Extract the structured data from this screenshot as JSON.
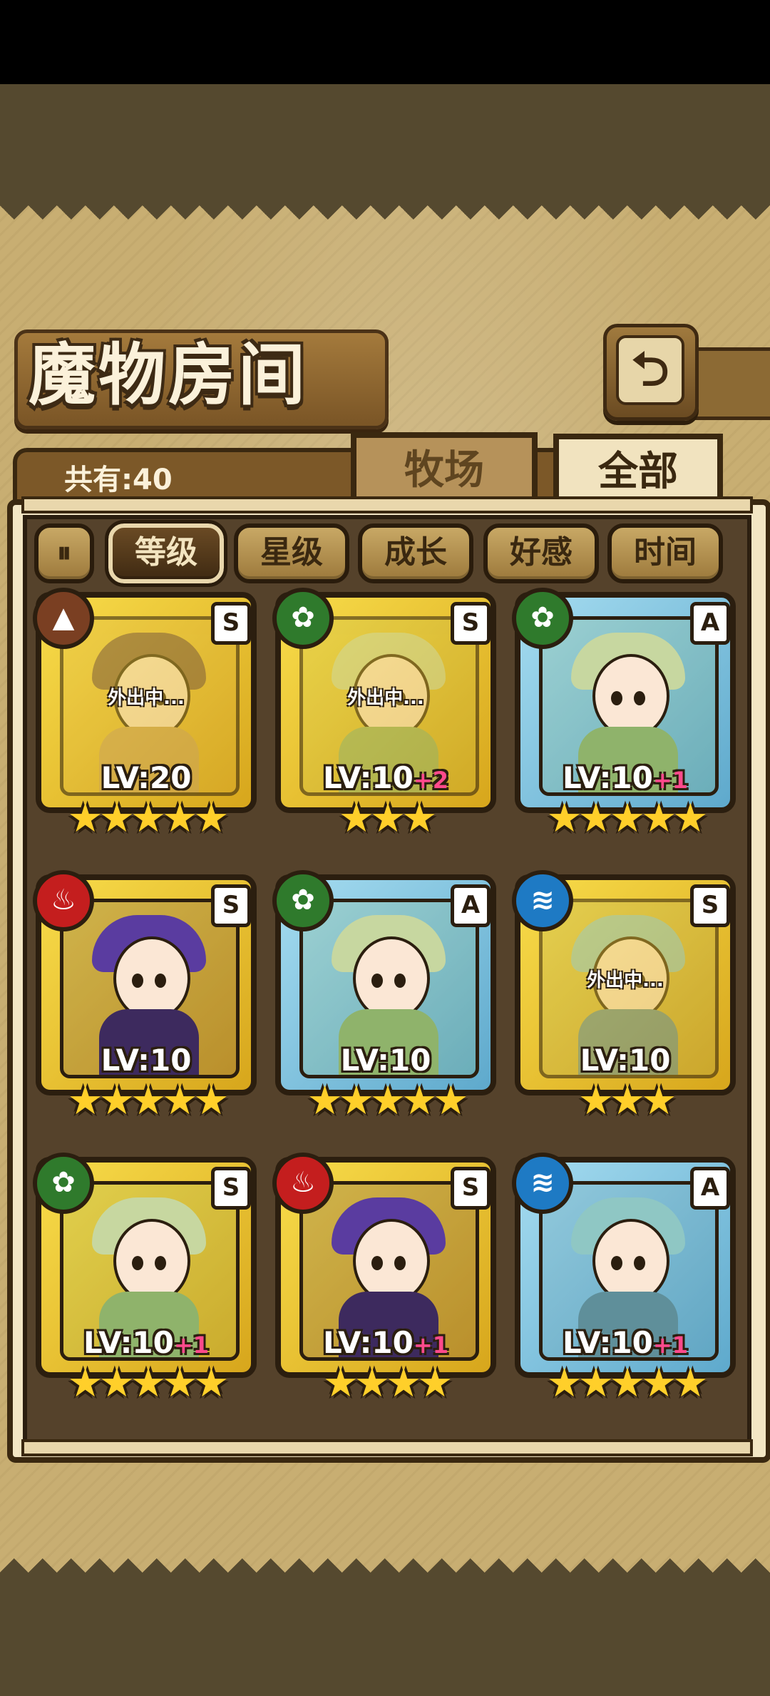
{
  "header": {
    "title": "魔物房间",
    "back_icon": "return-arrow-icon"
  },
  "info": {
    "count_label": "共有:40"
  },
  "tabs": [
    {
      "label": "牧场",
      "active": false
    },
    {
      "label": "全部",
      "active": true
    }
  ],
  "sort": {
    "order_icon": "sort-order-icon",
    "buttons": [
      {
        "label": "等级",
        "active": true
      },
      {
        "label": "星级",
        "active": false
      },
      {
        "label": "成长",
        "active": false
      },
      {
        "label": "好感",
        "active": false
      },
      {
        "label": "时间",
        "active": false
      }
    ]
  },
  "monsters": [
    {
      "element": "earth",
      "rank": "S",
      "level": "LV:20",
      "bonus": "",
      "stars": 5,
      "out_label": "外出中...",
      "frame": "gold"
    },
    {
      "element": "grass",
      "rank": "S",
      "level": "LV:10",
      "bonus": "+2",
      "stars": 3,
      "out_label": "外出中...",
      "frame": "gold"
    },
    {
      "element": "grass",
      "rank": "A",
      "level": "LV:10",
      "bonus": "+1",
      "stars": 5,
      "out_label": "",
      "frame": "blue"
    },
    {
      "element": "fire",
      "rank": "S",
      "level": "LV:10",
      "bonus": "",
      "stars": 5,
      "out_label": "",
      "frame": "gold"
    },
    {
      "element": "grass",
      "rank": "A",
      "level": "LV:10",
      "bonus": "",
      "stars": 5,
      "out_label": "",
      "frame": "blue"
    },
    {
      "element": "water",
      "rank": "S",
      "level": "LV:10",
      "bonus": "",
      "stars": 3,
      "out_label": "外出中...",
      "frame": "gold"
    },
    {
      "element": "grass",
      "rank": "S",
      "level": "LV:10",
      "bonus": "+1",
      "stars": 5,
      "out_label": "",
      "frame": "gold"
    },
    {
      "element": "fire",
      "rank": "S",
      "level": "LV:10",
      "bonus": "+1",
      "stars": 4,
      "out_label": "",
      "frame": "gold"
    },
    {
      "element": "water",
      "rank": "A",
      "level": "LV:10",
      "bonus": "+1",
      "stars": 5,
      "out_label": "",
      "frame": "blue"
    }
  ],
  "colors": {
    "gold_frame": "#f8dc4a",
    "blue_frame": "#a5dcf0",
    "plus_text": "#ff4a8c",
    "star": "#ffcf2a"
  }
}
